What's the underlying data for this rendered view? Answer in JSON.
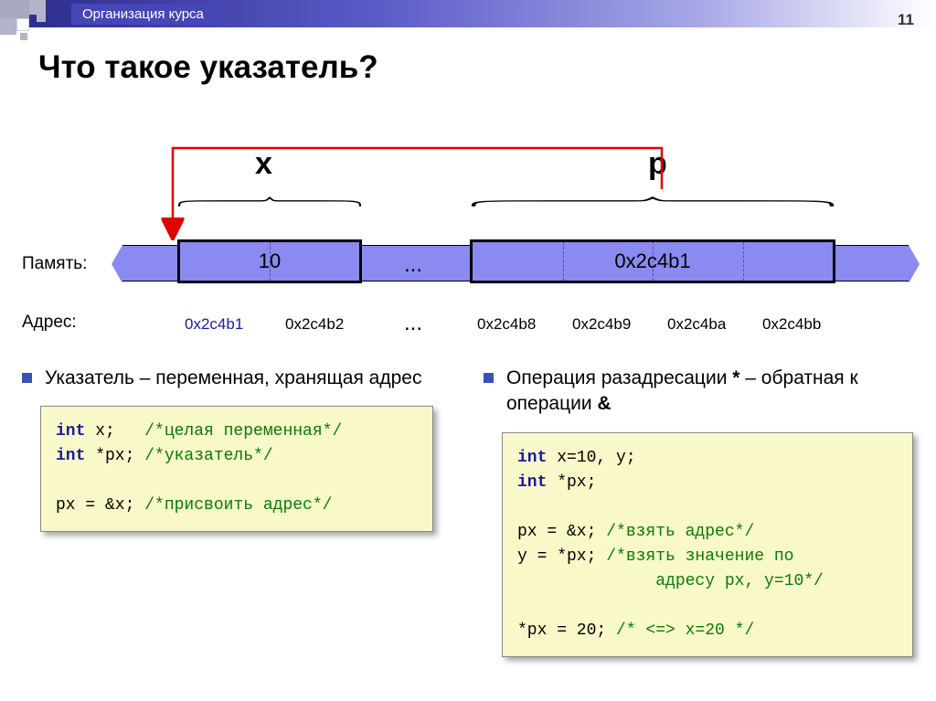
{
  "header": {
    "breadcrumb": "Организация курса",
    "page_number": "11"
  },
  "title": "Что такое указатель?",
  "diagram": {
    "var_x": "x",
    "var_p": "p",
    "mem_label": "Память:",
    "addr_label": "Адрес:",
    "cell_x_value": "10",
    "cell_p_value": "0x2c4b1",
    "ellipsis": "...",
    "addresses": {
      "x1": "0x2c4b1",
      "x2": "0x2c4b2",
      "p1": "0x2c4b8",
      "p2": "0x2c4b9",
      "p3": "0x2c4ba",
      "p4": "0x2c4bb"
    }
  },
  "left": {
    "bullet": "Указатель – переменная, хранящая адрес",
    "code": {
      "l1a": "int",
      "l1b": " x;   ",
      "l1c": "/*целая переменная*/",
      "l2a": "int",
      "l2b": " *px; ",
      "l2c": "/*указатель*/",
      "blank": " ",
      "l3a": "px = &x; ",
      "l3b": "/*присвоить адрес*/"
    }
  },
  "right": {
    "bullet_pre": "Операция разадресации ",
    "bullet_star": "*",
    "bullet_mid": " – обратная к операции ",
    "bullet_amp": "&",
    "code": {
      "l1a": "int",
      "l1b": " x=10, y;",
      "l2a": "int",
      "l2b": " *px;",
      "blank": " ",
      "l3a": "px = &x; ",
      "l3b": "/*взять адрес*/",
      "l4a": "y = *px; ",
      "l4b": "/*взять значение по",
      "l4c": "              адресу px, y=10*/",
      "blank2": " ",
      "l5a": "*px = 20; ",
      "l5b": "/* <=> x=20 */"
    }
  }
}
